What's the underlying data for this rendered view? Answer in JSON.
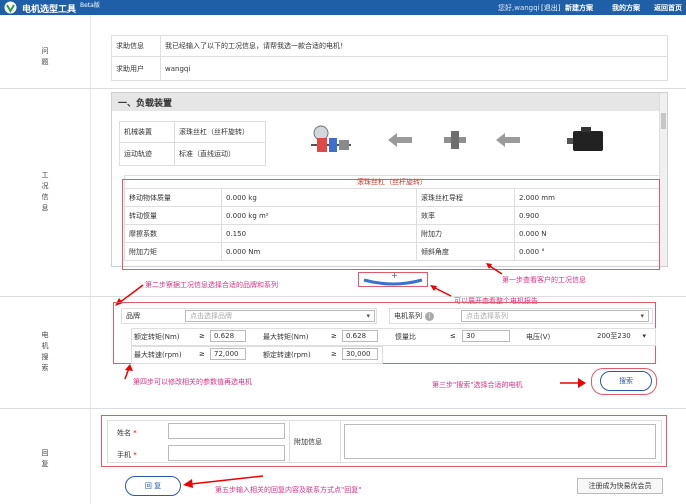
{
  "header": {
    "app_title": "电机选型工具",
    "beta": "Beta版",
    "greeting": "您好,wangqi",
    "logout": "[退出]",
    "new_scheme": "新建方案",
    "my_scheme": "我的方案",
    "back_home": "返回首页",
    "colors": {
      "bar": "#1f5fa8"
    }
  },
  "problem": {
    "section_label": "问\n题",
    "help_info_label": "求助信息",
    "help_info_text": "我已经输入了以下的工况信息，请帮我选一款合适的电机！",
    "help_user_label": "求助用户",
    "help_user_value": "wangqi"
  },
  "conditions": {
    "section_label": "工\n况\n信\n息",
    "panel_title": "一、负载装置",
    "mech_label": "机械装置",
    "mech_value": "滚珠丝杠（丝杆旋转）",
    "motion_label": "运动轨迹",
    "motion_value": "标准（直线运动）",
    "table_title": "滚珠丝杠（丝杆旋转）",
    "rows": [
      {
        "k1": "移动物体质量",
        "v1": "0.000 kg",
        "k2": "滚珠丝杠导程",
        "v2": "2.000 mm"
      },
      {
        "k1": "转动惯量",
        "v1": "0.000 kg m²",
        "k2": "效率",
        "v2": "0.900"
      },
      {
        "k1": "摩擦系数",
        "v1": "0.150",
        "k2": "附加力",
        "v2": "0.000 N"
      },
      {
        "k1": "附加力矩",
        "v1": "0.000 Nm",
        "k2": "倾斜角度",
        "v2": "0.000 °"
      }
    ]
  },
  "search": {
    "section_label": "电\n机\n搜\n索",
    "brand_label": "品牌",
    "brand_placeholder": "点击选择品牌",
    "series_label": "电机系列",
    "series_placeholder": "点击选择系列",
    "rated_torque_label": "额定转矩(Nm)",
    "ge": "≥",
    "le": "≤",
    "rated_torque_value": "0.628",
    "max_torque_label": "最大转矩(Nm)",
    "max_torque_value": "0.628",
    "inertia_ratio_label": "惯量比",
    "inertia_ratio_value": "30",
    "voltage_label": "电压(V)",
    "voltage_value": "200至230",
    "max_speed_label": "最大转速(rpm)",
    "max_speed_value": "72,000",
    "rated_speed_label": "额定转速(rpm)",
    "rated_speed_value": "30,000",
    "search_button": "搜索"
  },
  "reply": {
    "section_label": "回\n复",
    "name_label": "姓名",
    "phone_label": "手机",
    "required_mark": "*",
    "extra_label": "附加信息",
    "reply_button": "回 复",
    "register_button": "注册成为快易优会员"
  },
  "annotations": {
    "step1": "第一步查看客户的工况信息",
    "step2": "第二步察据工况信息选择合适的品牌和系列",
    "expand": "可以展开查看整个电机报告",
    "step3": "第三步\"搜索\"选择合适的电机",
    "step4": "第四步可以修改相关的参数值再选电机",
    "step5": "第五步输入相关的回复内容及联系方式点\"回复\""
  }
}
